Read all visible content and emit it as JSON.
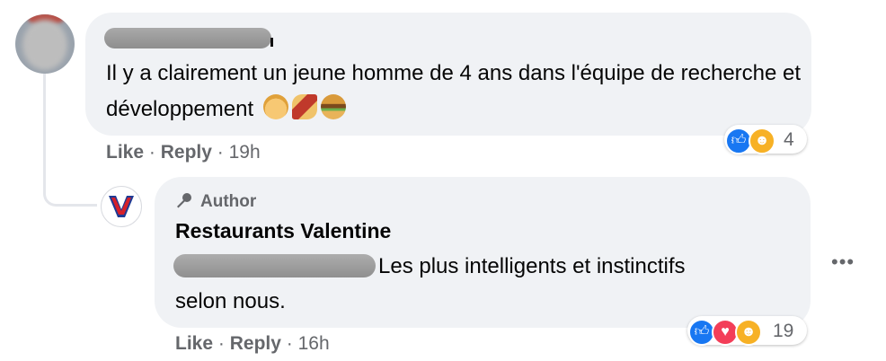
{
  "comment": {
    "text": "Il y a clairement un jeune homme de 4 ans dans l'équipe de recherche et développement",
    "emojis": [
      "baby-emoji",
      "hotdog-emoji",
      "burger-emoji"
    ],
    "actions": {
      "like": "Like",
      "reply": "Reply",
      "time": "19h",
      "sep": "·"
    },
    "reactions": {
      "types": [
        "like",
        "haha"
      ],
      "count": "4"
    }
  },
  "reply": {
    "badge": "Author",
    "author": "Restaurants Valentine",
    "text_line1": "Les plus intelligents et instinctifs",
    "text_line2": "selon nous.",
    "actions": {
      "like": "Like",
      "reply": "Reply",
      "time": "16h",
      "sep": "·"
    },
    "reactions": {
      "types": [
        "like",
        "love",
        "haha"
      ],
      "count": "19"
    }
  },
  "more_options": "•••",
  "colors": {
    "bubble": "#f0f2f5",
    "like": "#1877f2",
    "love": "#f33e58",
    "haha": "#f7b125",
    "muted": "#65676b"
  }
}
